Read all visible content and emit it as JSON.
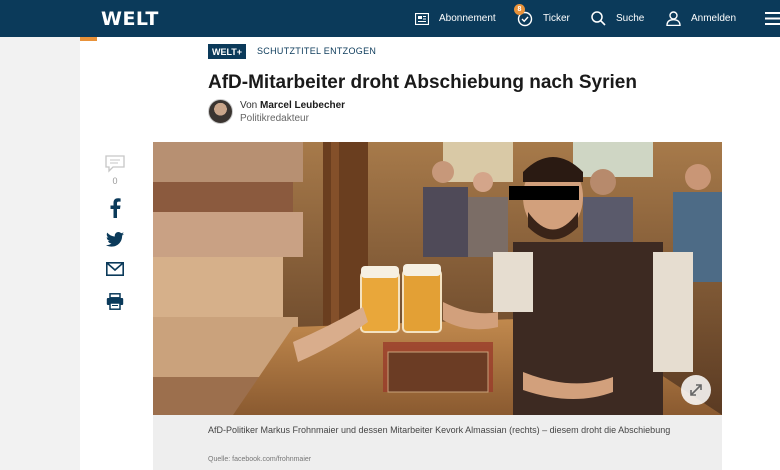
{
  "header": {
    "logo": "WELT",
    "nav": {
      "subscription": "Abonnement",
      "ticker": "Ticker",
      "ticker_badge": "8",
      "search": "Suche",
      "login": "Anmelden"
    }
  },
  "article": {
    "badge": "WELT+",
    "kicker": "SCHUTZTITEL ENTZOGEN",
    "headline": "AfD-Mitarbeiter droht Abschiebung nach Syrien",
    "byline_prefix": "Von",
    "author": "Marcel Leubecher",
    "author_role": "Politikredakteur",
    "comment_count": "0",
    "caption": "AfD-Politiker Markus Frohnmaier und dessen Mitarbeiter Kevork Almassian (rechts) – diesem droht die Abschiebung",
    "source": "Quelle: facebook.com/frohnmaier"
  },
  "colors": {
    "brand_navy": "#0b3a5a",
    "accent_orange": "#e8923a",
    "social_navy": "#0b3a5a",
    "ticker_badge": "#e8923a"
  }
}
